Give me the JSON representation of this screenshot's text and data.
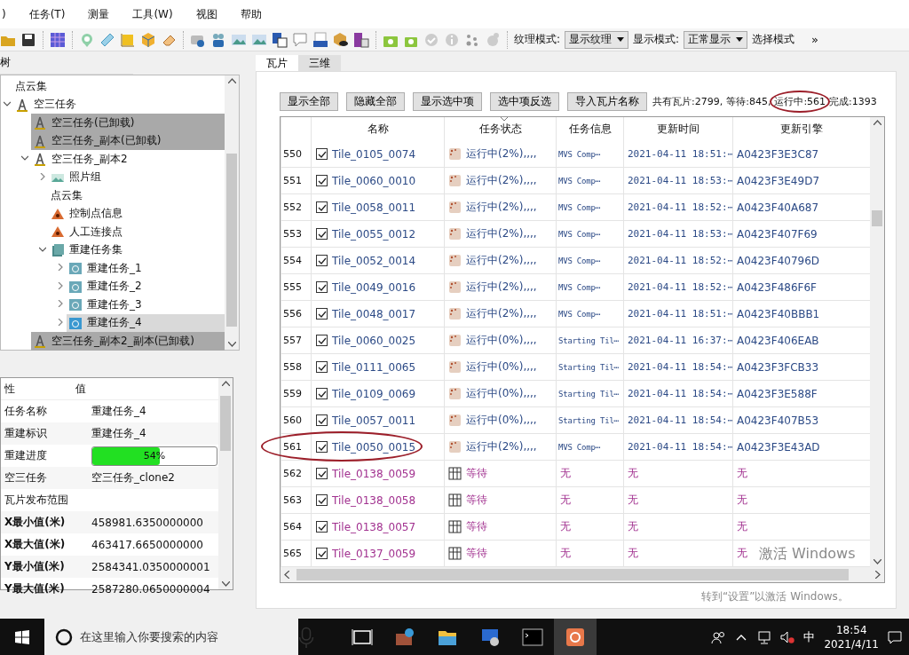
{
  "menu": [
    ")",
    "任务(T)",
    "测量",
    "工具(W)",
    "视图",
    "帮助"
  ],
  "toolbar": {
    "combos": [
      {
        "label": "纹理模式:",
        "value": "显示纹理"
      },
      {
        "label": "显示模式:",
        "value": "正常显示"
      }
    ],
    "trailing_label": "选择模式",
    "overflow": "»"
  },
  "tree": {
    "title": "树",
    "items": [
      {
        "label": "点云集",
        "kind": "plain"
      },
      {
        "label": "空三任务",
        "kind": "task",
        "expanded": true,
        "children": [
          {
            "label": "空三任务(已卸载)",
            "kind": "task",
            "unloaded": true
          },
          {
            "label": "空三任务_副本(已卸载)",
            "kind": "task",
            "unloaded": true
          },
          {
            "label": "空三任务_副本2",
            "kind": "task",
            "expanded": true,
            "children": [
              {
                "label": "照片组",
                "kind": "photos",
                "expanded": false
              },
              {
                "label": "点云集",
                "kind": "plain"
              },
              {
                "label": "控制点信息",
                "kind": "point"
              },
              {
                "label": "人工连接点",
                "kind": "point"
              },
              {
                "label": "重建任务集",
                "kind": "recon-set",
                "expanded": true,
                "children": [
                  {
                    "label": "重建任务_1",
                    "kind": "recon",
                    "expanded": false,
                    "selected": false
                  },
                  {
                    "label": "重建任务_2",
                    "kind": "recon",
                    "expanded": false,
                    "selected": false
                  },
                  {
                    "label": "重建任务_3",
                    "kind": "recon",
                    "expanded": false,
                    "selected": false
                  },
                  {
                    "label": "重建任务_4",
                    "kind": "recon",
                    "expanded": false,
                    "selected": true
                  }
                ]
              }
            ]
          },
          {
            "label": "空三任务_副本2_副本(已卸载)",
            "kind": "task",
            "unloaded": true
          }
        ]
      }
    ]
  },
  "properties": {
    "columns": [
      "性",
      "值"
    ],
    "rows": [
      {
        "kind": "text",
        "name": "任务名称",
        "value": "重建任务_4"
      },
      {
        "kind": "text",
        "name": "重建标识",
        "value": "重建任务_4"
      },
      {
        "kind": "progress",
        "name": "重建进度",
        "value": "54%",
        "level": 0.54
      },
      {
        "kind": "text",
        "name": "空三任务",
        "value": "空三任务_clone2"
      },
      {
        "kind": "section",
        "name": "瓦片发布范围"
      },
      {
        "kind": "bold",
        "name": "X最小值(米)",
        "value": "458981.6350000000"
      },
      {
        "kind": "bold",
        "name": "X最大值(米)",
        "value": "463417.6650000000"
      },
      {
        "kind": "bold",
        "name": "Y最小值(米)",
        "value": "2584341.0350000001"
      },
      {
        "kind": "bold",
        "name": "Y最大值(米)",
        "value": "2587280.0650000004"
      }
    ]
  },
  "tabs": [
    {
      "label": "瓦片",
      "selected": true
    },
    {
      "label": "三维",
      "selected": false
    }
  ],
  "buttons": [
    "显示全部",
    "隐藏全部",
    "显示选中项",
    "选中项反选",
    "导入瓦片名称"
  ],
  "stats": [
    {
      "text": "共有瓦片:2799,",
      "circled": false
    },
    {
      "text": "等待:845,",
      "circled": false
    },
    {
      "text": "运行中:561",
      "circled": true
    },
    {
      "text": "完成:1393",
      "circled": false
    }
  ],
  "table": {
    "columns": [
      "名称",
      "任务状态",
      "任务信息",
      "更新时间",
      "更新引擎"
    ],
    "rows": [
      {
        "num": "550",
        "checked": true,
        "name": "Tile_0105_0074",
        "kind": "running",
        "status": "运行中(2%),,,,",
        "info": "MVS Comp⋯",
        "time": "2021-04-11 18:51:⋯",
        "engine": "A0423F3E3C87",
        "circled": false
      },
      {
        "num": "551",
        "checked": true,
        "name": "Tile_0060_0010",
        "kind": "running",
        "status": "运行中(2%),,,,",
        "info": "MVS Comp⋯",
        "time": "2021-04-11 18:53:⋯",
        "engine": "A0423F3E49D7",
        "circled": false
      },
      {
        "num": "552",
        "checked": true,
        "name": "Tile_0058_0011",
        "kind": "running",
        "status": "运行中(2%),,,,",
        "info": "MVS Comp⋯",
        "time": "2021-04-11 18:52:⋯",
        "engine": "A0423F40A687",
        "circled": false
      },
      {
        "num": "553",
        "checked": true,
        "name": "Tile_0055_0012",
        "kind": "running",
        "status": "运行中(2%),,,,",
        "info": "MVS Comp⋯",
        "time": "2021-04-11 18:53:⋯",
        "engine": "A0423F407F69",
        "circled": false
      },
      {
        "num": "554",
        "checked": true,
        "name": "Tile_0052_0014",
        "kind": "running",
        "status": "运行中(2%),,,,",
        "info": "MVS Comp⋯",
        "time": "2021-04-11 18:52:⋯",
        "engine": "A0423F40796D",
        "circled": false
      },
      {
        "num": "555",
        "checked": true,
        "name": "Tile_0049_0016",
        "kind": "running",
        "status": "运行中(2%),,,,",
        "info": "MVS Comp⋯",
        "time": "2021-04-11 18:52:⋯",
        "engine": "A0423F486F6F",
        "circled": false
      },
      {
        "num": "556",
        "checked": true,
        "name": "Tile_0048_0017",
        "kind": "running",
        "status": "运行中(2%),,,,",
        "info": "MVS Comp⋯",
        "time": "2021-04-11 18:51:⋯",
        "engine": "A0423F40BBB1",
        "circled": false
      },
      {
        "num": "557",
        "checked": true,
        "name": "Tile_0060_0025",
        "kind": "running",
        "status": "运行中(0%),,,,",
        "info": "Starting Til⋯",
        "time": "2021-04-11 16:37:⋯",
        "engine": "A0423F406EAB",
        "circled": false
      },
      {
        "num": "558",
        "checked": true,
        "name": "Tile_0111_0065",
        "kind": "running",
        "status": "运行中(0%),,,,",
        "info": "Starting Til⋯",
        "time": "2021-04-11 18:54:⋯",
        "engine": "A0423F3FCB33",
        "circled": false
      },
      {
        "num": "559",
        "checked": true,
        "name": "Tile_0109_0069",
        "kind": "running",
        "status": "运行中(0%),,,,",
        "info": "Starting Til⋯",
        "time": "2021-04-11 18:54:⋯",
        "engine": "A0423F3E588F",
        "circled": false
      },
      {
        "num": "560",
        "checked": true,
        "name": "Tile_0057_0011",
        "kind": "running",
        "status": "运行中(0%),,,,",
        "info": "Starting Til⋯",
        "time": "2021-04-11 18:54:⋯",
        "engine": "A0423F407B53",
        "circled": false
      },
      {
        "num": "561",
        "checked": true,
        "name": "Tile_0050_0015",
        "kind": "running",
        "status": "运行中(2%),,,,",
        "info": "MVS Comp⋯",
        "time": "2021-04-11 18:54:⋯",
        "engine": "A0423F3E43AD",
        "circled": true
      },
      {
        "num": "562",
        "checked": true,
        "name": "Tile_0138_0059",
        "kind": "waiting",
        "status": "等待",
        "info": "无",
        "time": "无",
        "engine": "无",
        "circled": false
      },
      {
        "num": "563",
        "checked": true,
        "name": "Tile_0138_0058",
        "kind": "waiting",
        "status": "等待",
        "info": "无",
        "time": "无",
        "engine": "无",
        "circled": false
      },
      {
        "num": "564",
        "checked": true,
        "name": "Tile_0138_0057",
        "kind": "waiting",
        "status": "等待",
        "info": "无",
        "time": "无",
        "engine": "无",
        "circled": false
      },
      {
        "num": "565",
        "checked": true,
        "name": "Tile_0137_0059",
        "kind": "waiting",
        "status": "等待",
        "info": "无",
        "time": "无",
        "engine": "无",
        "circled": false
      }
    ]
  },
  "activation": {
    "title": "激活 Windows",
    "hint": "转到“设置”以激活 Windows。"
  },
  "taskbar": {
    "search_placeholder": "在这里输入你要搜索的内容",
    "ime": "中",
    "time": "18:54",
    "date": "2021/4/11"
  }
}
